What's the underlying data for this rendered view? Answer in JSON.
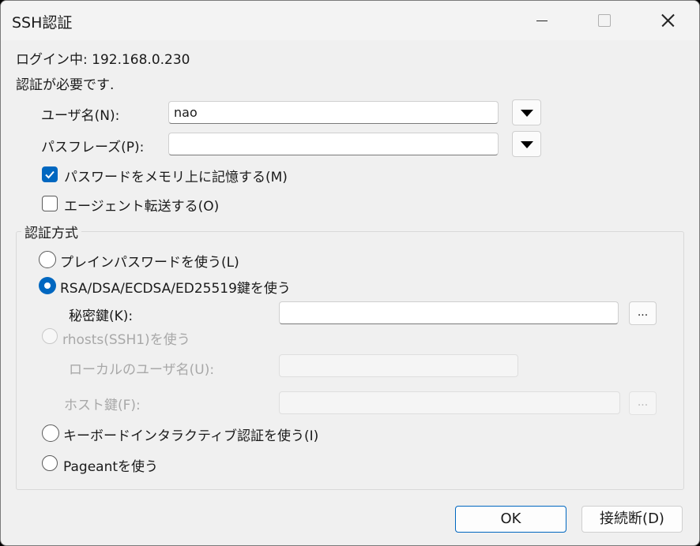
{
  "window": {
    "title": "SSH認証"
  },
  "login_line": "ログイン中: 192.168.0.230",
  "auth_required": "認証が必要です.",
  "username": {
    "label": "ユーザ名(N):",
    "value": "nao"
  },
  "passphrase": {
    "label": "パスフレーズ(P):",
    "value": ""
  },
  "remember_password": {
    "label": "パスワードをメモリ上に記憶する(M)",
    "checked": true
  },
  "agent_forward": {
    "label": "エージェント転送する(O)",
    "checked": false
  },
  "auth_method": {
    "legend": "認証方式",
    "plain_password": {
      "label": "プレインパスワードを使う(L)",
      "selected": false
    },
    "rsa_key": {
      "label": "RSA/DSA/ECDSA/ED25519鍵を使う",
      "selected": true
    },
    "private_key": {
      "label": "秘密鍵(K):",
      "value": "",
      "browse_label": "..."
    },
    "rhosts": {
      "label": "rhosts(SSH1)を使う",
      "enabled": false
    },
    "local_user": {
      "label": "ローカルのユーザ名(U):",
      "value": ""
    },
    "host_key": {
      "label": "ホスト鍵(F):",
      "value": "",
      "browse_label": "..."
    },
    "keyboard_interactive": {
      "label": "キーボードインタラクティブ認証を使う(I)",
      "selected": false
    },
    "pageant": {
      "label": "Pageantを使う",
      "selected": false
    }
  },
  "buttons": {
    "ok": "OK",
    "disconnect": "接続断(D)"
  },
  "colors": {
    "accent": "#0067c0",
    "disabled_text": "#a8a8a8"
  }
}
